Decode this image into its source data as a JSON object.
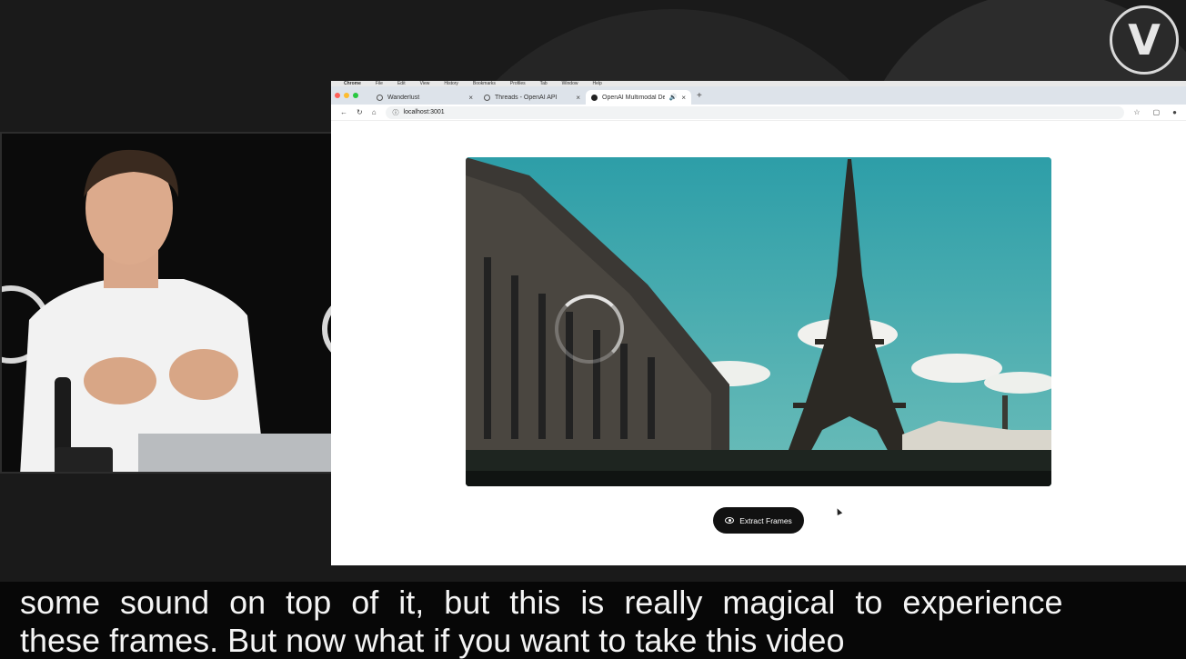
{
  "logo": {
    "letter": "V"
  },
  "browser": {
    "menubar": [
      "Chrome",
      "File",
      "Edit",
      "View",
      "History",
      "Bookmarks",
      "Profiles",
      "Tab",
      "Window",
      "Help"
    ],
    "tabs": [
      {
        "label": "Wanderlust",
        "active": false
      },
      {
        "label": "Threads - OpenAI API",
        "active": false
      },
      {
        "label": "OpenAI Multimodal Demo",
        "active": true
      }
    ],
    "url": "localhost:3001"
  },
  "app": {
    "extract_button_label": "Extract Frames",
    "loading": true
  },
  "captions": {
    "line1": "some sound on top of it, but this is really magical to experience",
    "line2": "these frames. But now what if you want to take this video"
  },
  "colors": {
    "sky": "#3fa2aa",
    "button": "#111111",
    "caption_bg": "#070707"
  }
}
